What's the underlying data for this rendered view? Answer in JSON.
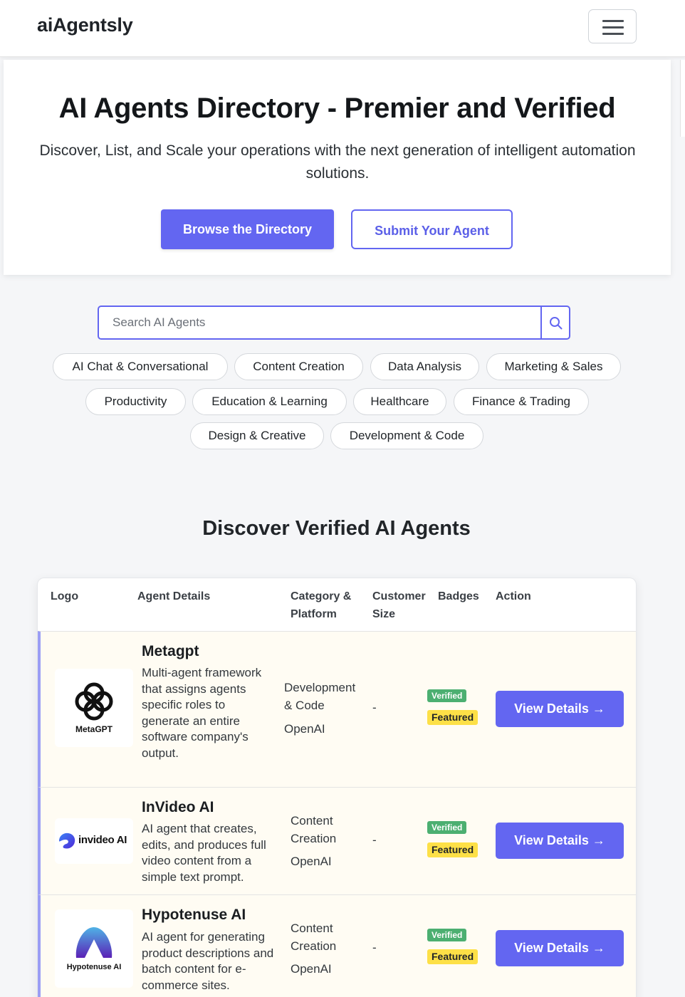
{
  "navbar": {
    "brand": "aiAgentsly",
    "menu_icon": "hamburger-menu-icon"
  },
  "hero": {
    "title": "AI Agents Directory - Premier and Verified",
    "subtitle": "Discover, List, and Scale your operations with the next generation of intelligent automation solutions.",
    "browse_label": "Browse the Directory",
    "submit_label": "Submit Your Agent"
  },
  "search": {
    "placeholder": "Search AI Agents",
    "icon": "search-icon"
  },
  "categories": [
    "AI Chat & Conversational",
    "Content Creation",
    "Data Analysis",
    "Marketing & Sales",
    "Productivity",
    "Education & Learning",
    "Healthcare",
    "Finance & Trading",
    "Design & Creative",
    "Development & Code"
  ],
  "section_title": "Discover Verified AI Agents",
  "table": {
    "headers": {
      "logo": "Logo",
      "details": "Agent Details",
      "category_line1": "Category &",
      "category_line2": "Platform",
      "size_line1": "Customer",
      "size_line2": "Size",
      "badges": "Badges",
      "action": "Action"
    },
    "rows": [
      {
        "logo_text": "MetaGPT",
        "name": "Metagpt",
        "description": "Multi-agent framework that assigns agents specific roles to generate an entire software company's output.",
        "category_line1": "Development",
        "category_line2": "& Code",
        "platform": "OpenAI",
        "customer_size": "-",
        "badge_verified": "Verified",
        "badge_featured": "Featured",
        "action_label": "View Details →"
      },
      {
        "logo_text": "invideo AI",
        "name": "InVideo AI",
        "description": "AI agent that creates, edits, and produces full video content from a simple text prompt.",
        "category_line1": "Content",
        "category_line2": "Creation",
        "platform": "OpenAI",
        "customer_size": "-",
        "badge_verified": "Verified",
        "badge_featured": "Featured",
        "action_label": "View Details →"
      },
      {
        "logo_text": "Hypotenuse AI",
        "name": "Hypotenuse AI",
        "description": "AI agent for generating product descriptions and batch content for e-commerce sites.",
        "category_line1": "Content",
        "category_line2": "Creation",
        "platform": "OpenAI",
        "customer_size": "-",
        "badge_verified": "Verified",
        "badge_featured": "Featured",
        "action_label": "View Details →"
      }
    ]
  },
  "colors": {
    "accent": "#6366f1",
    "verified": "#4caf71",
    "featured": "#fde047",
    "row_bg": "#fffcf3"
  }
}
